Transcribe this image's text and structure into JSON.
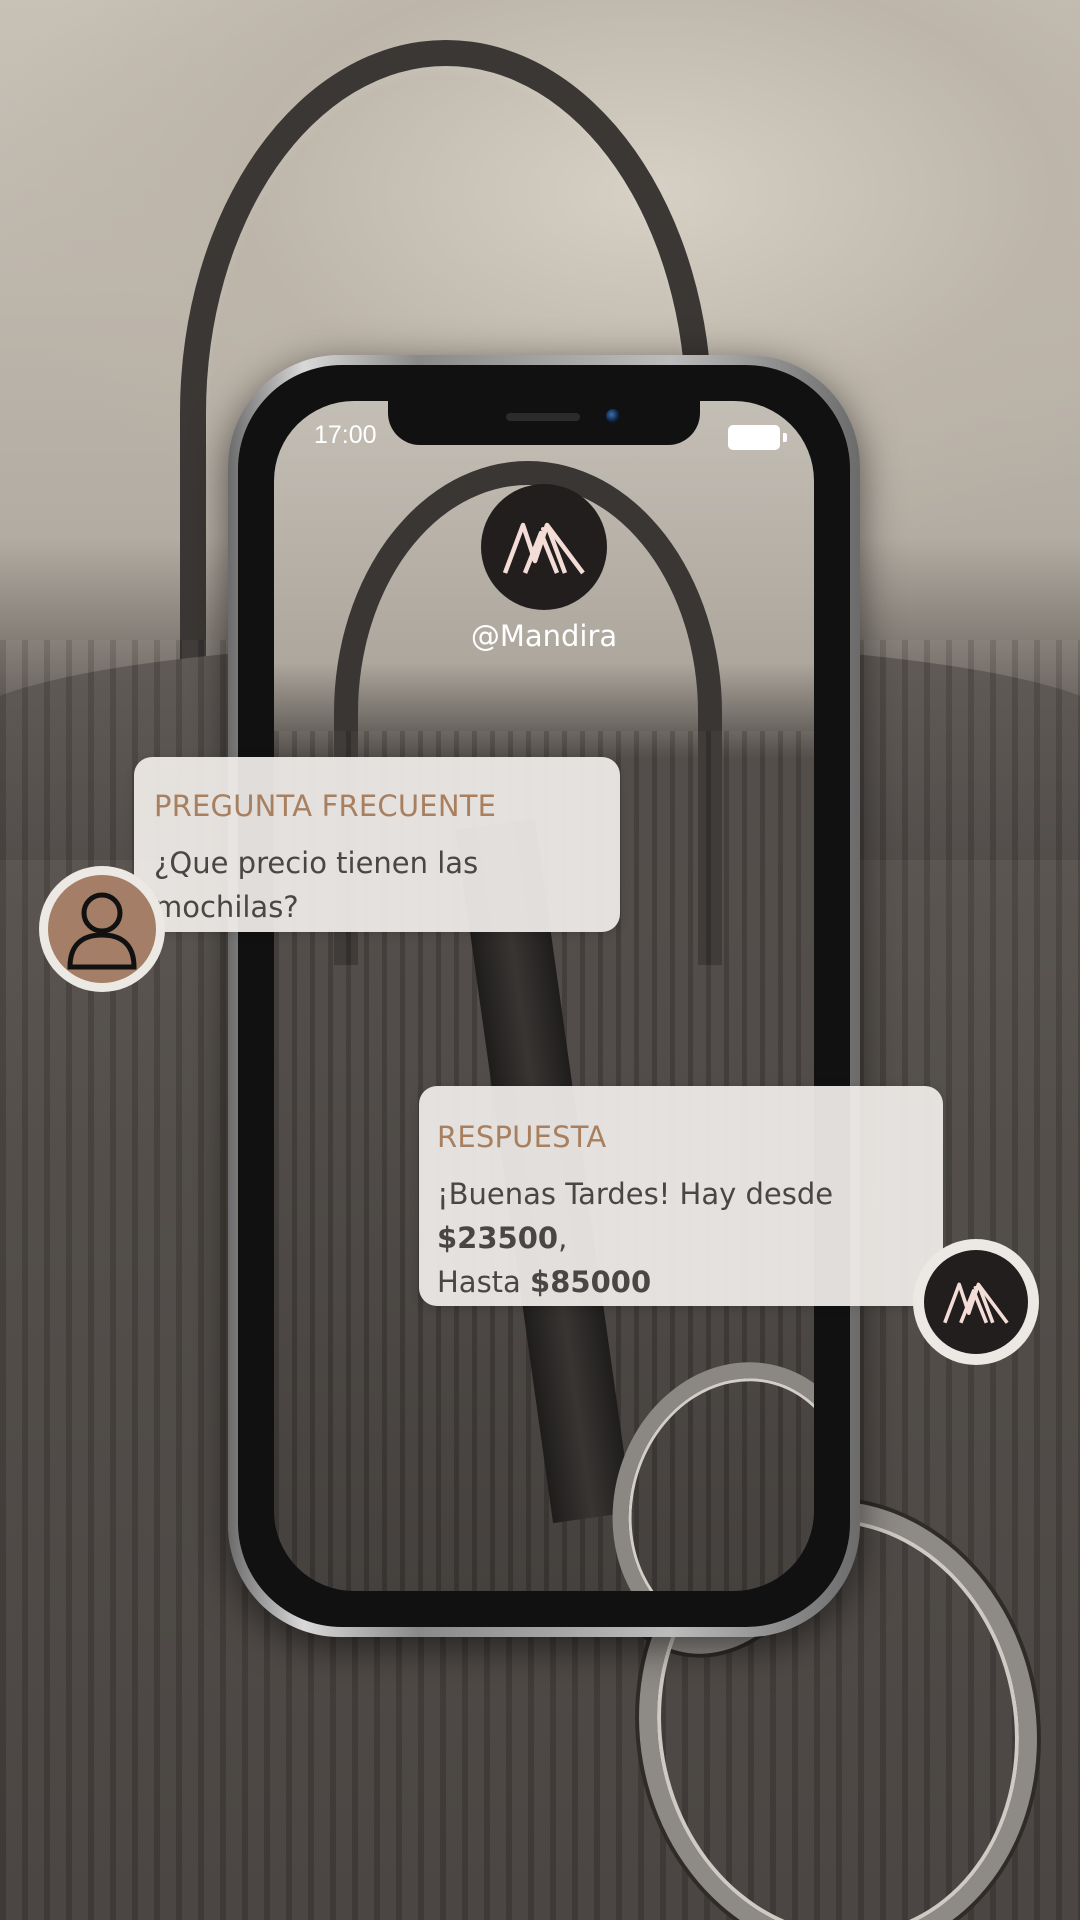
{
  "status_bar": {
    "time": "17:00"
  },
  "profile": {
    "handle": "@Mandira",
    "logo": "mandira-logo-icon"
  },
  "question": {
    "title": "PREGUNTA FRECUENTE",
    "text": "¿Que precio tienen las mochilas?",
    "avatar": "user-icon"
  },
  "answer": {
    "title": "RESPUESTA",
    "text_prefix": "¡Buenas Tardes! Hay desde ",
    "price_from": "$23500",
    "text_mid": ",",
    "text_hasta": "Hasta ",
    "price_to": "$85000",
    "avatar": "mandira-logo-icon"
  },
  "colors": {
    "accent": "#a88060",
    "bubble_bg": "#f0ede9",
    "logo_bg": "#221e1e",
    "logo_fg": "#f3ddd6"
  }
}
